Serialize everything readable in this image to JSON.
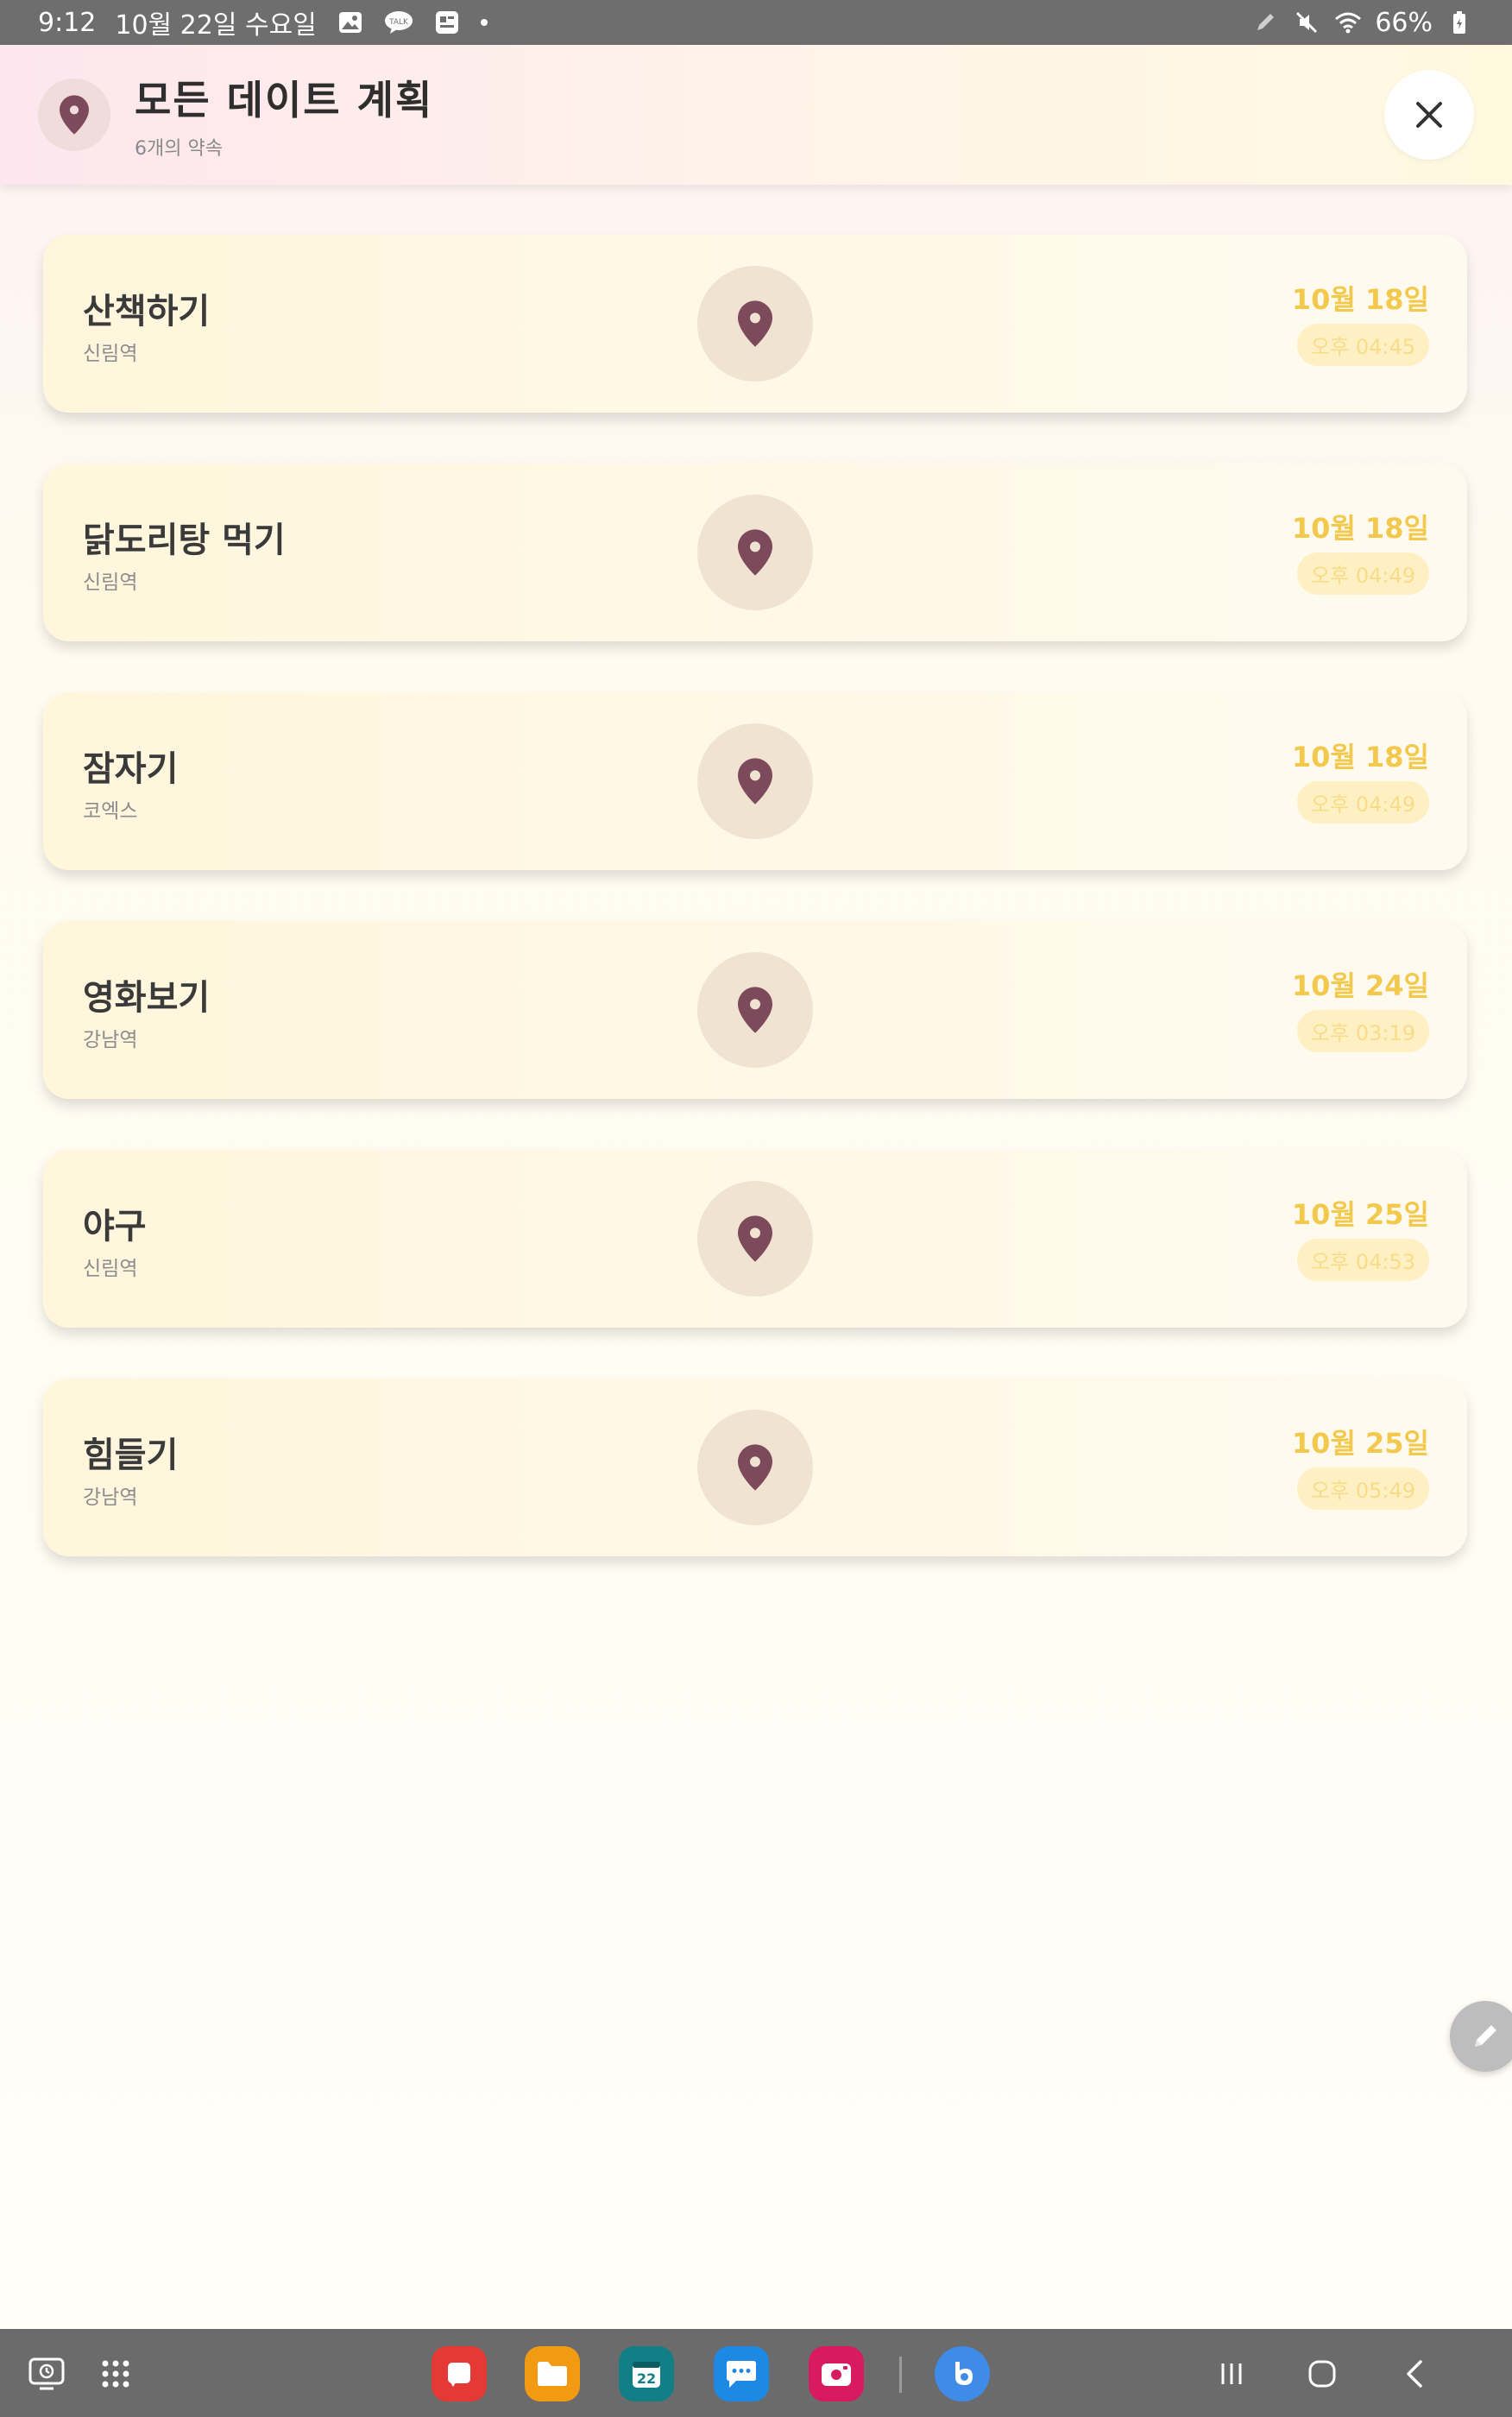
{
  "status_bar": {
    "time": "9:12",
    "date": "10월 22일 수요일",
    "battery": "66%",
    "notification_icons": [
      "gallery-icon",
      "kakaotalk-icon",
      "app-notification-icon"
    ],
    "system_icons": [
      "pen-icon",
      "mute-icon",
      "wifi-icon",
      "battery-icon"
    ]
  },
  "header": {
    "title": "모든 데이트 계획",
    "subtitle": "6개의 약속",
    "icon": "location-pin-icon",
    "close_icon": "close-icon"
  },
  "plans": [
    {
      "title": "산책하기",
      "location": "신림역",
      "date": "10월 18일",
      "time": "오후 04:45"
    },
    {
      "title": "닭도리탕 먹기",
      "location": "신림역",
      "date": "10월 18일",
      "time": "오후 04:49"
    },
    {
      "title": "잠자기",
      "location": "코엑스",
      "date": "10월 18일",
      "time": "오후 04:49"
    },
    {
      "title": "영화보기",
      "location": "강남역",
      "date": "10월 24일",
      "time": "오후 03:19"
    },
    {
      "title": "야구",
      "location": "신림역",
      "date": "10월 25일",
      "time": "오후 04:53"
    },
    {
      "title": "힘들기",
      "location": "강남역",
      "date": "10월 25일",
      "time": "오후 05:49"
    }
  ],
  "fab": {
    "icon": "pencil-icon"
  },
  "taskbar": {
    "left_icons": [
      "screen-capture-icon",
      "app-drawer-icon"
    ],
    "apps": [
      {
        "icon": "notes-app-icon",
        "color": "#e53935"
      },
      {
        "icon": "my-files-app-icon",
        "color": "#f29b12"
      },
      {
        "icon": "calendar-app-icon",
        "color": "#127f86",
        "label": "22"
      },
      {
        "icon": "messages-app-icon",
        "color": "#1e88e5"
      },
      {
        "icon": "screen-recorder-app-icon",
        "color": "#d81b60"
      },
      {
        "icon": "bixby-app-icon",
        "color": "#3f8be8"
      }
    ],
    "nav_icons": [
      "recents-icon",
      "home-icon",
      "back-icon"
    ]
  },
  "colors": {
    "pin": "#7d4a5c",
    "date_accent": "#f2c94c",
    "time_text": "#f8dc88"
  }
}
